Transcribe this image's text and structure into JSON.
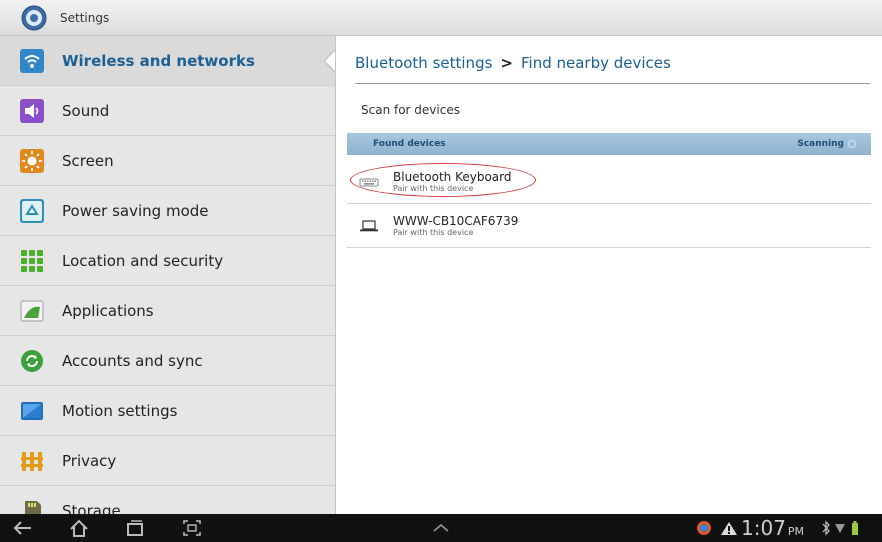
{
  "window": {
    "title": "Settings",
    "icon": "settings-gear-icon"
  },
  "sidebar": {
    "items": [
      {
        "label": "Wireless and networks",
        "icon": "wifi-icon",
        "active": true
      },
      {
        "label": "Sound",
        "icon": "speaker-icon",
        "active": false
      },
      {
        "label": "Screen",
        "icon": "brightness-icon",
        "active": false
      },
      {
        "label": "Power saving mode",
        "icon": "recycle-icon",
        "active": false
      },
      {
        "label": "Location and security",
        "icon": "grid-location-icon",
        "active": false
      },
      {
        "label": "Applications",
        "icon": "applications-icon",
        "active": false
      },
      {
        "label": "Accounts and sync",
        "icon": "sync-icon",
        "active": false
      },
      {
        "label": "Motion settings",
        "icon": "motion-icon",
        "active": false
      },
      {
        "label": "Privacy",
        "icon": "privacy-icon",
        "active": false
      },
      {
        "label": "Storage",
        "icon": "sd-card-icon",
        "active": false
      }
    ]
  },
  "main": {
    "breadcrumb": {
      "parent": "Bluetooth settings",
      "separator": ">",
      "current": "Find nearby devices"
    },
    "scan_label": "Scan for devices",
    "found_header": {
      "title": "Found devices",
      "status": "Scanning"
    },
    "devices": [
      {
        "name": "Bluetooth Keyboard",
        "subtitle": "Pair with this device",
        "icon": "keyboard-icon",
        "highlighted": true
      },
      {
        "name": "WWW-CB10CAF6739",
        "subtitle": "Pair with this device",
        "icon": "laptop-icon",
        "highlighted": false
      }
    ]
  },
  "navbar": {
    "clock": {
      "time": "1:07",
      "ampm": "PM"
    },
    "icons": [
      "back-icon",
      "home-icon",
      "recent-apps-icon",
      "screenshot-icon",
      "up-chevron-icon",
      "notification-icon",
      "warning-icon",
      "bluetooth-icon",
      "signal-icon",
      "battery-icon"
    ]
  },
  "colors": {
    "accent": "#1b5f93",
    "header_bar": "#9dbdd6",
    "highlight_ring": "#d23a3a"
  }
}
